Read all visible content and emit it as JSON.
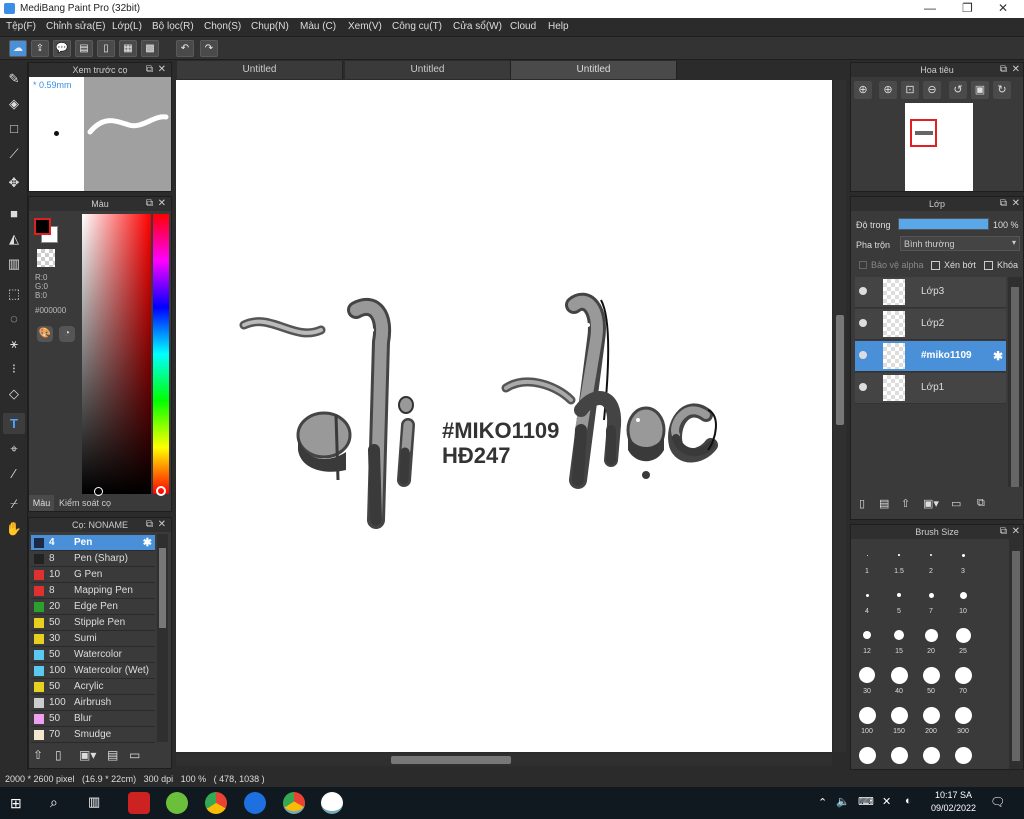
{
  "app": {
    "title": "MediBang Paint Pro (32bit)",
    "minimize": "—",
    "maximize": "❐",
    "close": "✕"
  },
  "menu": {
    "items": [
      "Tệp(F)",
      "Chỉnh sửa(E)",
      "Lớp(L)",
      "Bộ lọc(R)",
      "Chọn(S)",
      "Chụp(N)",
      "Màu (C)",
      "Xem(V)",
      "Công cụ(T)",
      "Cửa sổ(W)",
      "Cloud",
      "Help"
    ]
  },
  "tabs": [
    "Untitled",
    "Untitled",
    "Untitled"
  ],
  "brush_preview": {
    "title": "Xem trước cọ",
    "size": "* 0.59mm"
  },
  "color_panel": {
    "title": "Màu",
    "fg_color": "#000000",
    "r": "R:0",
    "g": "G:0",
    "b": "B:0",
    "hex": "#000000",
    "tab_color": "Màu",
    "tab_brush_control": "Kiểm soát cọ"
  },
  "brush_list": {
    "title": "Cọ: NONAME",
    "items": [
      {
        "size": "4",
        "name": "Pen",
        "color": "#1e2a44",
        "selected": true
      },
      {
        "size": "8",
        "name": "Pen (Sharp)",
        "color": "#222222"
      },
      {
        "size": "10",
        "name": "G Pen",
        "color": "#e03030"
      },
      {
        "size": "8",
        "name": "Mapping Pen",
        "color": "#e03030"
      },
      {
        "size": "20",
        "name": "Edge Pen",
        "color": "#2ca02c"
      },
      {
        "size": "50",
        "name": "Stipple Pen",
        "color": "#e8d020"
      },
      {
        "size": "30",
        "name": "Sumi",
        "color": "#e8d020"
      },
      {
        "size": "50",
        "name": "Watercolor",
        "color": "#5bc8f0"
      },
      {
        "size": "100",
        "name": "Watercolor (Wet)",
        "color": "#5bc8f0"
      },
      {
        "size": "50",
        "name": "Acrylic",
        "color": "#e8d020"
      },
      {
        "size": "100",
        "name": "Airbrush",
        "color": "#cccccc"
      },
      {
        "size": "50",
        "name": "Blur",
        "color": "#f0a0f0"
      },
      {
        "size": "70",
        "name": "Smudge",
        "color": "#f5e6d0"
      }
    ]
  },
  "canvas_art": {
    "tag_line1": "#MIKO1109",
    "tag_line2": "HĐ247"
  },
  "navigator": {
    "title": "Hoa tiêu"
  },
  "layers": {
    "title": "Lớp",
    "opacity_label": "Độ trong",
    "opacity_value": "100 %",
    "opacity_fraction": 1.0,
    "blend_label": "Pha trộn",
    "blend_value": "Bình thường",
    "protect_alpha": "Bảo vệ alpha",
    "clipping": "Xén bớt",
    "lock": "Khóa",
    "items": [
      {
        "name": "Lớp3",
        "selected": false
      },
      {
        "name": "Lớp2",
        "selected": false
      },
      {
        "name": "#miko1109",
        "selected": true
      },
      {
        "name": "Lớp1",
        "selected": false
      }
    ]
  },
  "brush_size": {
    "title": "Brush Size",
    "sizes": [
      "1",
      "1.5",
      "2",
      "3",
      "4",
      "5",
      "7",
      "10",
      "12",
      "15",
      "20",
      "25",
      "30",
      "40",
      "50",
      "70",
      "100",
      "150",
      "200",
      "300"
    ]
  },
  "status": {
    "text": "2000 * 2600 pixel   (16.9 * 22cm)   300 dpi   100 %   ( 478, 1038 )"
  },
  "taskbar": {
    "time": "10:17 SA",
    "date": "09/02/2022"
  }
}
